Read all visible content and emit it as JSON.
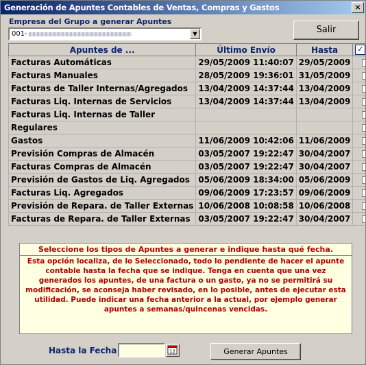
{
  "window": {
    "title": "Generación de Apuntes Contables de Ventas, Compras y Gastos",
    "close_label": "×"
  },
  "company": {
    "label": "Empresa del Grupo a generar Apuntes",
    "value_prefix": "001-"
  },
  "buttons": {
    "salir": "Salir",
    "generar": "Generar Apuntes"
  },
  "table": {
    "headers": [
      "Apuntes de ...",
      "Último Envío",
      "Hasta"
    ],
    "rows": [
      {
        "name": "Facturas Automáticas",
        "last": "29/05/2009 11:40:07",
        "until": "29/05/2009"
      },
      {
        "name": "Facturas Manuales",
        "last": "28/05/2009 19:36:01",
        "until": "31/05/2009"
      },
      {
        "name": "Facturas de Taller Internas/Agregados",
        "last": "13/04/2009 14:37:44",
        "until": "13/04/2009"
      },
      {
        "name": "Facturas Liq. Internas de Servicios",
        "last": "13/04/2009 14:37:44",
        "until": "13/04/2009"
      },
      {
        "name": "Facturas Liq. Internas de Taller",
        "last": "",
        "until": ""
      },
      {
        "name": "Regulares",
        "last": "",
        "until": ""
      },
      {
        "name": "Gastos",
        "last": "11/06/2009 10:42:06",
        "until": "11/06/2009"
      },
      {
        "name": "Previsión Compras de Almacén",
        "last": "03/05/2007 19:22:47",
        "until": "30/04/2007"
      },
      {
        "name": "Facturas Compras de Almacén",
        "last": "03/05/2007 19:22:47",
        "until": "30/04/2007"
      },
      {
        "name": "Previsión de Gastos de Liq. Agregados",
        "last": "05/06/2009 18:34:00",
        "until": "05/06/2009"
      },
      {
        "name": "Facturas Liq. Agregados",
        "last": "09/06/2009 17:23:57",
        "until": "09/06/2009"
      },
      {
        "name": "Previsión de Repara. de Taller Externas",
        "last": "10/06/2008 10:08:58",
        "until": "10/06/2008"
      },
      {
        "name": "Facturas de Repara. de Taller Externas",
        "last": "03/05/2007 19:22:47",
        "until": "30/04/2007"
      }
    ]
  },
  "info": {
    "title": "Seleccione los tipos de Apuntes a generar e indique hasta qué fecha.",
    "body": "Esta opción localiza, de lo Seleccionado, todo lo pendiente de hacer el apunte contable hasta la fecha que se indique. Tenga en cuenta que una vez generados los apuntes, de una factura o un gasto, ya no se permitirá su modificación, se aconseja haber revisado, en lo posible, antes de ejecutar esta utilidad. Puede indicar una fecha anterior a la actual, por ejemplo generar apuntes a semanas/quincenas vencidas."
  },
  "date_filter": {
    "label": "Hasta la Fecha",
    "value": ""
  },
  "colors": {
    "title_start": "#0a246a",
    "title_end": "#a6caf0",
    "info_text": "#b00000",
    "info_bg": "#ffffe1"
  }
}
